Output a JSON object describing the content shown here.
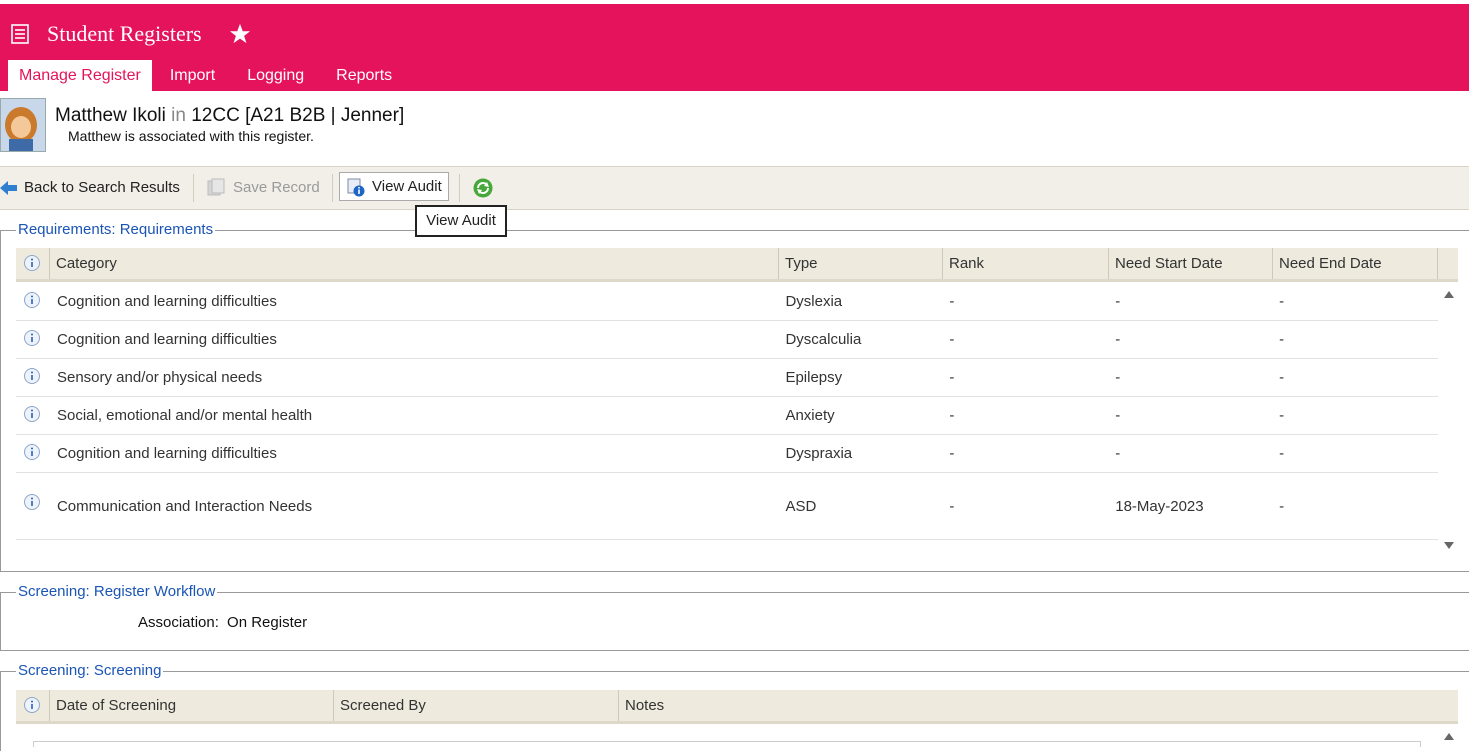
{
  "app": {
    "title": "Student Registers"
  },
  "tabs": [
    "Manage Register",
    "Import",
    "Logging",
    "Reports"
  ],
  "student": {
    "name": "Matthew Ikoli",
    "in_word": "in",
    "group": "12CC [A21 B2B | Jenner]",
    "status": "Matthew is associated with this register."
  },
  "toolbar": {
    "back_label": "Back to Search Results",
    "save_label": "Save Record",
    "audit_label": "View Audit",
    "tooltip": "View Audit"
  },
  "requirements": {
    "legend": "Requirements: Requirements",
    "headers": [
      "Category",
      "Type",
      "Rank",
      "Need Start Date",
      "Need End Date"
    ],
    "rows": [
      [
        "Cognition and learning difficulties",
        "Dyslexia",
        "-",
        "-",
        "-"
      ],
      [
        "Cognition and learning difficulties",
        "Dyscalculia",
        "-",
        "-",
        "-"
      ],
      [
        "Sensory and/or physical needs",
        "Epilepsy",
        "-",
        "-",
        "-"
      ],
      [
        "Social, emotional and/or mental health",
        "Anxiety",
        "-",
        "-",
        "-"
      ],
      [
        "Cognition and learning difficulties",
        "Dyspraxia",
        "-",
        "-",
        "-"
      ],
      [
        "Communication and Interaction Needs",
        "ASD",
        "-",
        "18-May-2023",
        "-"
      ]
    ]
  },
  "workflow": {
    "legend": "Screening: Register Workflow",
    "association_label": "Association:",
    "association_value": "On Register"
  },
  "screening": {
    "legend": "Screening: Screening",
    "headers": [
      "Date of Screening",
      "Screened By",
      "Notes"
    ]
  },
  "colors": {
    "brand": "#e5135b",
    "link": "#1a55b5",
    "toolbar_bg": "#f1efe8"
  }
}
